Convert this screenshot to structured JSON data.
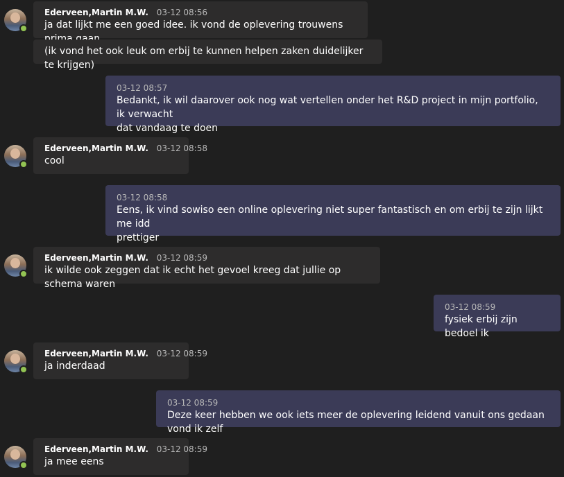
{
  "messages": [
    {
      "type": "in",
      "sender": "Ederveen,Martin M.W.",
      "time": "03-12 08:56",
      "text": "ja dat lijkt me een goed idee. ik vond de oplevering trouwens prima gaan"
    },
    {
      "type": "in-cont",
      "text": "(ik vond het ook leuk om erbij te kunnen helpen zaken duidelijker te krijgen)"
    },
    {
      "type": "out",
      "time": "03-12 08:57",
      "text_line1": "Bedankt, ik wil daarover ook nog wat vertellen onder het R&D project in mijn portfolio, ik verwacht",
      "text_line2": "dat vandaag te doen"
    },
    {
      "type": "in",
      "sender": "Ederveen,Martin M.W.",
      "time": "03-12 08:58",
      "text": "cool"
    },
    {
      "type": "out",
      "time": "03-12 08:58",
      "text_line1": "Eens, ik vind sowiso een online oplevering niet super fantastisch en om erbij te zijn lijkt me idd",
      "text_line2": "prettiger"
    },
    {
      "type": "in",
      "sender": "Ederveen,Martin M.W.",
      "time": "03-12 08:59",
      "text": "ik wilde ook zeggen dat ik echt het gevoel kreeg dat jullie op schema waren"
    },
    {
      "type": "out",
      "time": "03-12 08:59",
      "text": "fysiek erbij zijn bedoel ik"
    },
    {
      "type": "in",
      "sender": "Ederveen,Martin M.W.",
      "time": "03-12 08:59",
      "text": "ja inderdaad"
    },
    {
      "type": "out",
      "time": "03-12 08:59",
      "text": "Deze keer hebben we ook iets meer de oplevering leidend vanuit ons gedaan vond ik zelf"
    },
    {
      "type": "in",
      "sender": "Ederveen,Martin M.W.",
      "time": "03-12 08:59",
      "text": "ja mee eens"
    }
  ],
  "colors": {
    "incoming": "#2d2c2c",
    "outgoing": "#3b3b57",
    "status": "#92c353",
    "background": "#1f1f1f"
  }
}
